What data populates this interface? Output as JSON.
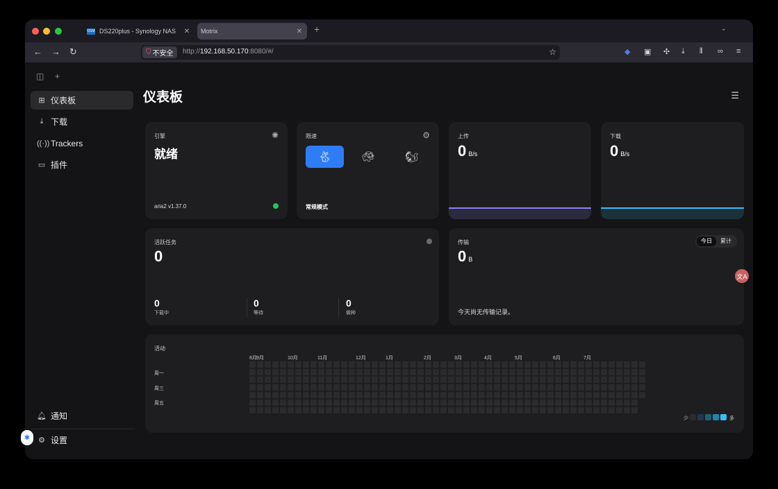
{
  "browser": {
    "tabs": [
      {
        "favicon": "DSM",
        "title": "DS220plus - Synology NAS"
      },
      {
        "title": "Motrix"
      }
    ],
    "insecure_label": "不安全",
    "url_prefix": "http://",
    "url_host": "192.168.50.170",
    "url_suffix": ":8080/#/",
    "new_tab_symbol": "+",
    "icons": [
      "back-icon",
      "forward-icon",
      "reload-icon",
      "star-icon",
      "bitwarden-icon",
      "shield-extension-icon",
      "extensions-icon",
      "downloads-icon",
      "library-icon",
      "infinity-icon",
      "menu-icon"
    ]
  },
  "sidebar": {
    "items": [
      {
        "label": "仪表板",
        "icon": "dashboard-icon",
        "active": true
      },
      {
        "label": "下载",
        "icon": "download-icon"
      },
      {
        "label": "Trackers",
        "icon": "antenna-icon"
      },
      {
        "label": "插件",
        "icon": "plugin-icon"
      }
    ],
    "notify_label": "通知",
    "settings_label": "设置"
  },
  "main": {
    "title": "仪表板",
    "engine": {
      "label": "引擎",
      "status": "就绪",
      "version": "aria2 v1.37.0",
      "dot_color": "#22c55e"
    },
    "speed_limit": {
      "label": "限速",
      "mode": "常规模式"
    },
    "upload": {
      "label": "上传",
      "value": "0",
      "unit": "B/s",
      "line_color": "#8b7ff5"
    },
    "download": {
      "label": "下载",
      "value": "0",
      "unit": "B/s",
      "line_color": "#38bdf8"
    },
    "active_tasks": {
      "label": "活跃任务",
      "value": "0",
      "downloading_value": "0",
      "downloading_label": "下载中",
      "waiting_value": "0",
      "waiting_label": "等待",
      "seeding_value": "0",
      "seeding_label": "做种"
    },
    "transfer": {
      "label": "传输",
      "value": "0",
      "unit": "B",
      "tab_today": "今日",
      "tab_total": "累计",
      "empty": "今天尚无传输记录。"
    },
    "activity": {
      "label": "活动",
      "months": [
        "8月",
        "9月",
        "10月",
        "11月",
        "12月",
        "1月",
        "2月",
        "3月",
        "4月",
        "5月",
        "6月",
        "7月"
      ],
      "weekdays": [
        "周一",
        "周三",
        "周五"
      ],
      "legend_less": "少",
      "legend_more": "多",
      "legend_colors": [
        "#2b2b2e",
        "#1e3a4a",
        "#1f5f78",
        "#1f88a8",
        "#38bdf8"
      ]
    }
  }
}
